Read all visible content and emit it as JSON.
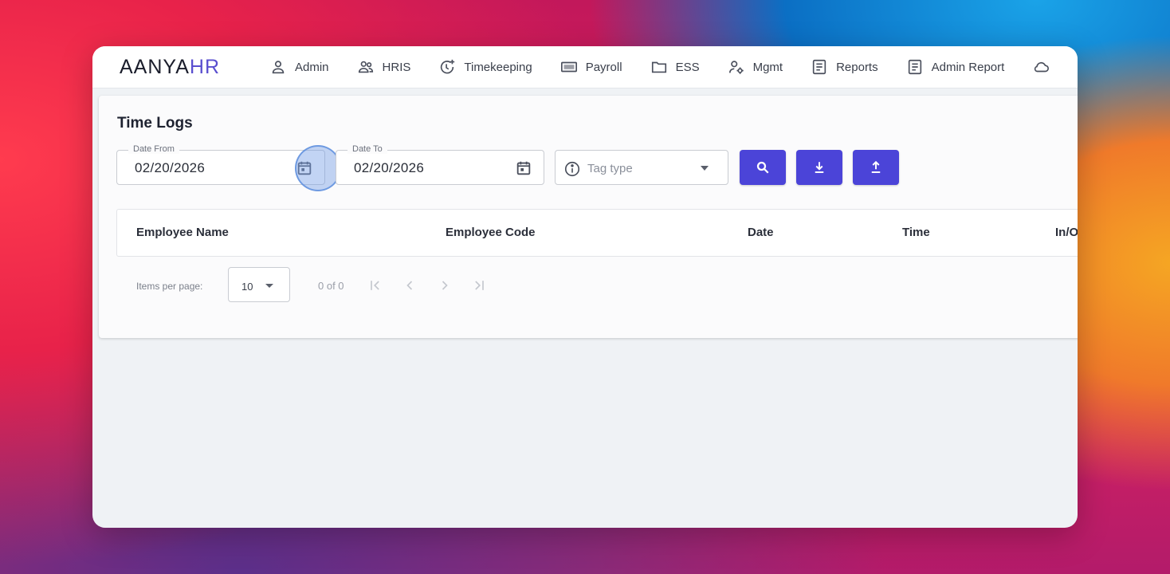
{
  "logo": {
    "part1": "AANYA",
    "part2": "HR"
  },
  "nav": [
    {
      "label": "Admin",
      "icon": "person-icon"
    },
    {
      "label": "HRIS",
      "icon": "people-icon"
    },
    {
      "label": "Timekeeping",
      "icon": "clock-plus-icon"
    },
    {
      "label": "Payroll",
      "icon": "money-icon"
    },
    {
      "label": "ESS",
      "icon": "folder-icon"
    },
    {
      "label": "Mgmt",
      "icon": "user-gear-icon"
    },
    {
      "label": "Reports",
      "icon": "document-icon"
    },
    {
      "label": "Admin Report",
      "icon": "document-icon"
    }
  ],
  "page": {
    "title": "Time Logs"
  },
  "filters": {
    "date_from": {
      "label": "Date From",
      "value": "02/20/2026"
    },
    "date_to": {
      "label": "Date To",
      "value": "02/20/2026"
    },
    "tag_type": {
      "placeholder": "Tag type"
    }
  },
  "table": {
    "columns": [
      "Employee Name",
      "Employee Code",
      "Date",
      "Time",
      "In/O"
    ]
  },
  "pagination": {
    "items_per_page_label": "Items per page:",
    "page_size": "10",
    "range": "0 of 0"
  },
  "colors": {
    "accent": "#4b44d8",
    "logo_accent": "#5a4fcf"
  }
}
